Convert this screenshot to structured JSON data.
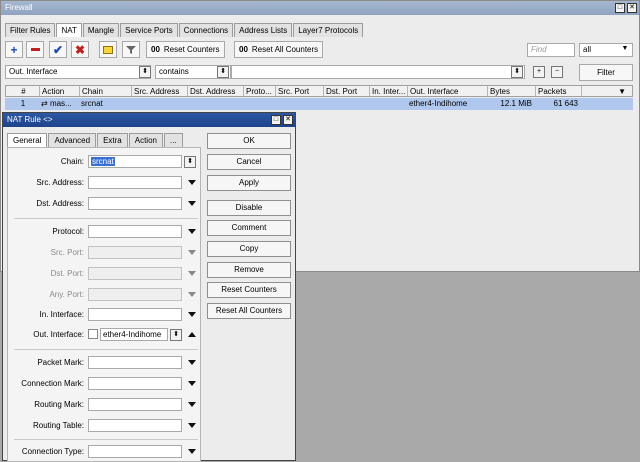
{
  "firewall": {
    "title": "Firewall",
    "tabs": [
      {
        "label": "Filter Rules",
        "active": false
      },
      {
        "label": "NAT",
        "active": true
      },
      {
        "label": "Mangle",
        "active": false
      },
      {
        "label": "Service Ports",
        "active": false
      },
      {
        "label": "Connections",
        "active": false
      },
      {
        "label": "Address Lists",
        "active": false
      },
      {
        "label": "Layer7 Protocols",
        "active": false
      }
    ],
    "toolbar": {
      "add_icon": "plus-icon",
      "remove_icon": "minus-icon",
      "enable_icon": "check-icon",
      "disable_icon": "x-icon",
      "comment_icon": "note-icon",
      "filter_icon": "funnel-icon",
      "reset_counters": "Reset Counters",
      "reset_all_counters": "Reset All Counters",
      "zero_glyph": "00",
      "find_placeholder": "Find",
      "scope_value": "all"
    },
    "filter": {
      "field": "Out. Interface",
      "operator": "contains",
      "value": "",
      "filter_button": "Filter"
    },
    "columns": [
      "#",
      "Action",
      "Chain",
      "Src. Address",
      "Dst. Address",
      "Proto...",
      "Src. Port",
      "Dst. Port",
      "In. Inter...",
      "Out. Interface",
      "Bytes",
      "Packets"
    ],
    "rows": [
      {
        "num": "1",
        "action": "mas...",
        "chain": "srcnat",
        "src_address": "",
        "dst_address": "",
        "protocol": "",
        "src_port": "",
        "dst_port": "",
        "in_interface": "",
        "out_interface": "ether4-Indihome",
        "bytes": "12.1 MiB",
        "packets": "61 643"
      }
    ]
  },
  "nat_dialog": {
    "title": "NAT Rule <>",
    "tabs": [
      "General",
      "Advanced",
      "Extra",
      "Action",
      "..."
    ],
    "fields": {
      "chain": {
        "label": "Chain:",
        "value": "srcnat"
      },
      "src_address": {
        "label": "Src. Address:",
        "value": ""
      },
      "dst_address": {
        "label": "Dst. Address:",
        "value": ""
      },
      "protocol": {
        "label": "Protocol:",
        "value": ""
      },
      "src_port": {
        "label": "Src. Port:",
        "value": ""
      },
      "dst_port": {
        "label": "Dst. Port:",
        "value": ""
      },
      "any_port": {
        "label": "Any. Port:",
        "value": ""
      },
      "in_interface": {
        "label": "In. Interface:",
        "value": ""
      },
      "out_interface": {
        "label": "Out. Interface:",
        "value": "ether4-Indihome"
      },
      "packet_mark": {
        "label": "Packet Mark:",
        "value": ""
      },
      "connection_mark": {
        "label": "Connection Mark:",
        "value": ""
      },
      "routing_mark": {
        "label": "Routing Mark:",
        "value": ""
      },
      "routing_table": {
        "label": "Routing Table:",
        "value": ""
      },
      "connection_type": {
        "label": "Connection Type:",
        "value": ""
      }
    },
    "buttons": [
      "OK",
      "Cancel",
      "Apply",
      "Disable",
      "Comment",
      "Copy",
      "Remove",
      "Reset Counters",
      "Reset All Counters"
    ]
  }
}
